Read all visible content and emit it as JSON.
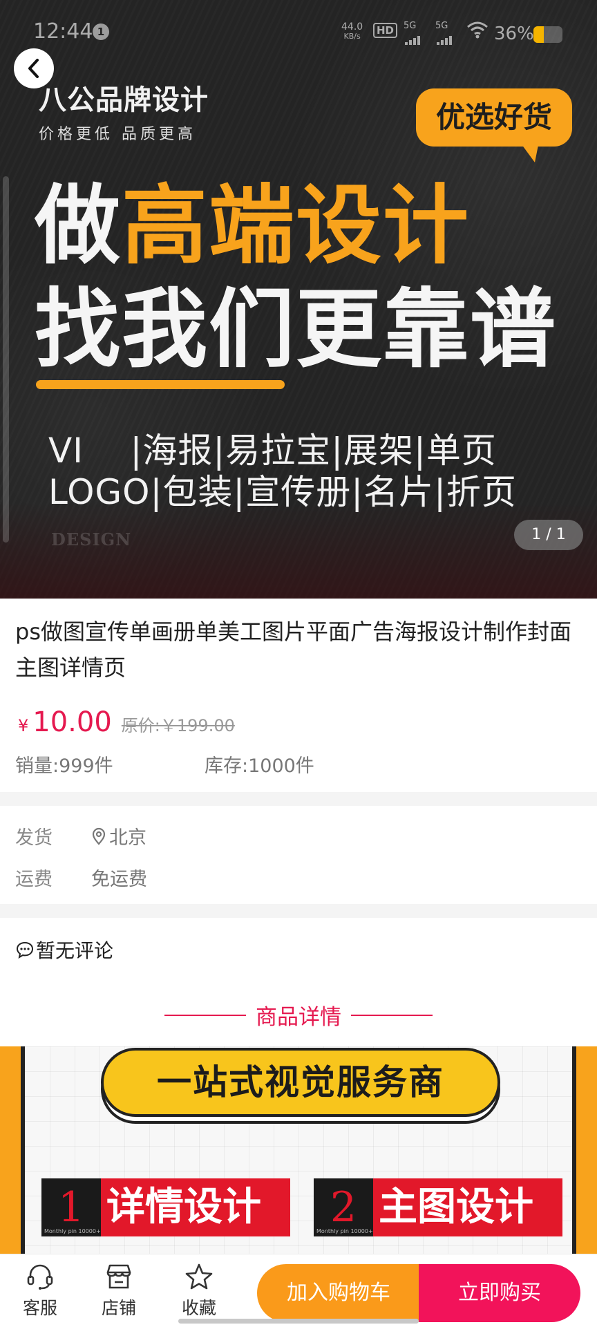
{
  "status_bar": {
    "time": "12:44",
    "notification_count": "1",
    "net_speed_value": "44.0",
    "net_speed_unit": "KB/s",
    "hd_label": "HD",
    "signal_1": "5G",
    "signal_2": "5G",
    "battery_pct": "36%",
    "battery_level": 0.36
  },
  "banner": {
    "brand_name": "八公品牌设计",
    "brand_slogan": "价格更低  品质更高",
    "bubble": "优选好货",
    "headline_1_white": "做",
    "headline_1_orange": "高端设计",
    "headline_2": "找我们更靠谱",
    "services_line_1": "VI    |海报|易拉宝|展架|单页",
    "services_line_2": "LOGO|包装|宣传册|名片|折页",
    "watermark": "DESIGN",
    "page_indicator": "1 / 1"
  },
  "product": {
    "title": "ps做图宣传单画册单美工图片平面广告海报设计制作封面主图详情页",
    "price_symbol": "¥",
    "price": "10.00",
    "original_price": "原价:￥199.00",
    "sales": "销量:999件",
    "stock": "库存:1000件"
  },
  "shipping": {
    "ship_label": "发货",
    "ship_value": "北京",
    "fee_label": "运费",
    "fee_value": "免运费"
  },
  "comments": {
    "text": "暂无评论"
  },
  "detail": {
    "header": "商品详情",
    "pill_text": "一站式视觉服务商",
    "tag_1_num": "1",
    "tag_1_text": "详情设计",
    "tag_2_num": "2",
    "tag_2_text": "主图设计",
    "tag_small": "Monthly pin 10000+"
  },
  "bottom_bar": {
    "service_label": "客服",
    "shop_label": "店铺",
    "favorite_label": "收藏",
    "cart_button": "加入购物车",
    "buy_button": "立即购买"
  },
  "colors": {
    "accent_red": "#e5194f",
    "accent_orange": "#f8a31c",
    "cart_orange": "#fa9a1a",
    "buy_pink": "#f2135a"
  }
}
